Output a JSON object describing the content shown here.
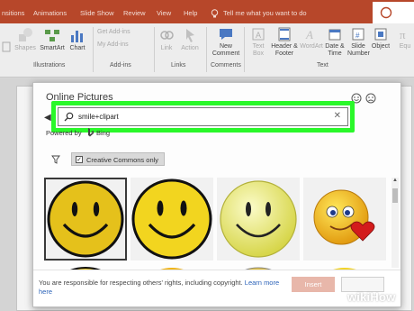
{
  "ribbon_tabs": [
    "nsitions",
    "Animations",
    "Slide Show",
    "Review",
    "View",
    "Help"
  ],
  "tell_me": "Tell me what you want to do",
  "ribbon": {
    "shapes": "Shapes",
    "smartart": "SmartArt",
    "chart": "Chart",
    "get_addins": "Get Add-ins",
    "my_addins": "My Add-ins",
    "link": "Link",
    "action": "Action",
    "new_comment": "New Comment",
    "text_box": "Text Box",
    "header_footer": "Header & Footer",
    "wordart": "WordArt",
    "date_time": "Date & Time",
    "slide_number": "Slide Number",
    "object": "Object",
    "equation": "Equ"
  },
  "ribbon_groups": {
    "illustrations": "Illustrations",
    "addins": "Add-ins",
    "links": "Links",
    "comments": "Comments",
    "text": "Text"
  },
  "dialog": {
    "title": "Online Pictures",
    "search_value": "smile+clipart",
    "powered_by": "Powered by",
    "bing": "Bing",
    "filter_label": "Creative Commons only",
    "filter_checked": true,
    "footer_text": "You are responsible for respecting others' rights, including copyright.",
    "learn_more": "Learn more here",
    "insert_label": "Insert"
  },
  "colors": {
    "ribbon_accent": "#b7472a",
    "highlight_outline": "#2af82a",
    "insert_button": "#e8b7aa"
  },
  "watermark": "wikiHow"
}
